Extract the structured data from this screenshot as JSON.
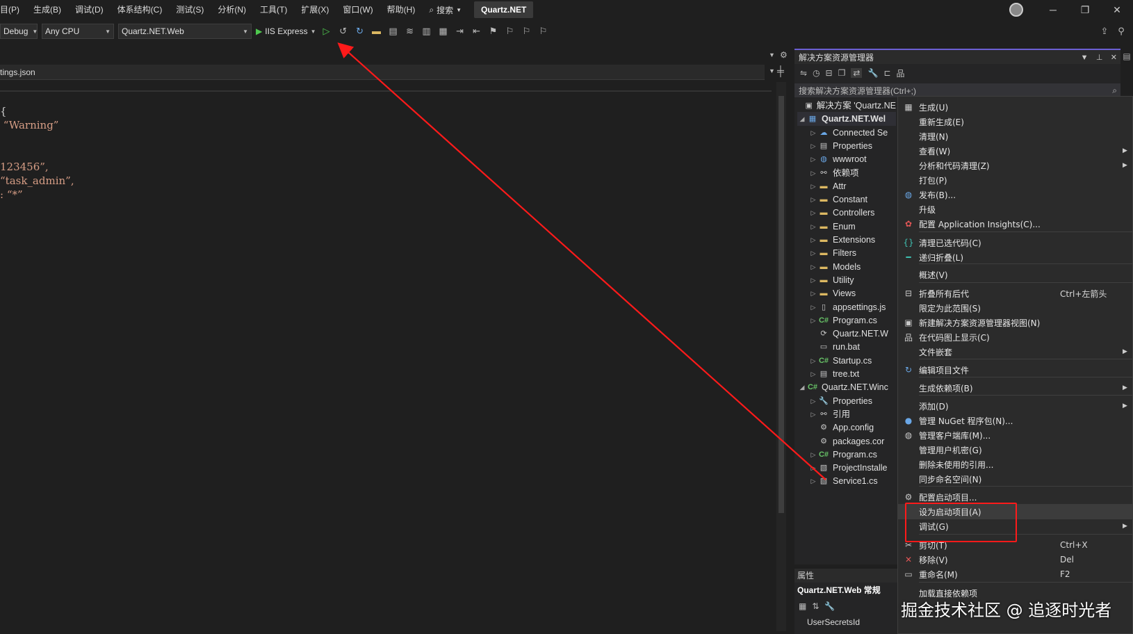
{
  "menubar": {
    "items": [
      "目(P)",
      "生成(B)",
      "调试(D)",
      "体系结构(C)",
      "测试(S)",
      "分析(N)",
      "工具(T)",
      "扩展(X)",
      "窗口(W)",
      "帮助(H)"
    ],
    "search_label": "搜索",
    "title_tab": "Quartz.NET"
  },
  "toolbar": {
    "config": "Debug",
    "platform": "Any CPU",
    "project": "Quartz.NET.Web",
    "run_target": "IIS Express"
  },
  "editor": {
    "tab_label": "tings.json",
    "code_lines": [
      {
        "text": "{",
        "cls": "punc"
      },
      {
        "text": " “Warning”",
        "cls": "str"
      },
      {
        "text": "",
        "cls": "punc"
      },
      {
        "text": "",
        "cls": "punc"
      },
      {
        "text": "123456”,",
        "cls": "str"
      },
      {
        "text": "“task_admin”,",
        "cls": "str"
      },
      {
        "text": ": “*”",
        "cls": "str"
      }
    ]
  },
  "solution_explorer": {
    "title": "解决方案资源管理器",
    "search_placeholder": "搜索解决方案资源管理器(Ctrl+;)",
    "tree": [
      {
        "label": "解决方案 'Quartz.NE",
        "icon": "solution-icon",
        "glyph": "▣",
        "cls": "ic-grey",
        "exp": "",
        "lvl": 0,
        "bold": false
      },
      {
        "label": "Quartz.NET.Wel",
        "icon": "web-project-icon",
        "glyph": "▦",
        "cls": "ic-blue",
        "exp": "◢",
        "lvl": 0,
        "bold": true
      },
      {
        "label": "Connected Se",
        "icon": "connected-services-icon",
        "glyph": "☁",
        "cls": "ic-blue",
        "exp": "▷",
        "lvl": 1,
        "bold": false
      },
      {
        "label": "Properties",
        "icon": "properties-icon",
        "glyph": "▤",
        "cls": "ic-grey",
        "exp": "▷",
        "lvl": 1,
        "bold": false
      },
      {
        "label": "wwwroot",
        "icon": "globe-icon",
        "glyph": "◍",
        "cls": "ic-blue",
        "exp": "▷",
        "lvl": 1,
        "bold": false
      },
      {
        "label": "依赖项",
        "icon": "dependencies-icon",
        "glyph": "⚯",
        "cls": "ic-grey",
        "exp": "▷",
        "lvl": 1,
        "bold": false
      },
      {
        "label": "Attr",
        "icon": "folder-icon",
        "glyph": "▬",
        "cls": "ic-folder",
        "exp": "▷",
        "lvl": 1,
        "bold": false
      },
      {
        "label": "Constant",
        "icon": "folder-icon",
        "glyph": "▬",
        "cls": "ic-folder",
        "exp": "▷",
        "lvl": 1,
        "bold": false
      },
      {
        "label": "Controllers",
        "icon": "folder-icon",
        "glyph": "▬",
        "cls": "ic-folder",
        "exp": "▷",
        "lvl": 1,
        "bold": false
      },
      {
        "label": "Enum",
        "icon": "folder-icon",
        "glyph": "▬",
        "cls": "ic-folder",
        "exp": "▷",
        "lvl": 1,
        "bold": false
      },
      {
        "label": "Extensions",
        "icon": "folder-icon",
        "glyph": "▬",
        "cls": "ic-folder",
        "exp": "▷",
        "lvl": 1,
        "bold": false
      },
      {
        "label": "Filters",
        "icon": "folder-icon",
        "glyph": "▬",
        "cls": "ic-folder",
        "exp": "▷",
        "lvl": 1,
        "bold": false
      },
      {
        "label": "Models",
        "icon": "folder-icon",
        "glyph": "▬",
        "cls": "ic-folder",
        "exp": "▷",
        "lvl": 1,
        "bold": false
      },
      {
        "label": "Utility",
        "icon": "folder-icon",
        "glyph": "▬",
        "cls": "ic-folder",
        "exp": "▷",
        "lvl": 1,
        "bold": false
      },
      {
        "label": "Views",
        "icon": "folder-icon",
        "glyph": "▬",
        "cls": "ic-folder",
        "exp": "▷",
        "lvl": 1,
        "bold": false
      },
      {
        "label": "appsettings.js",
        "icon": "json-file-icon",
        "glyph": "▯",
        "cls": "ic-grey",
        "exp": "▷",
        "lvl": 1,
        "bold": false
      },
      {
        "label": "Program.cs",
        "icon": "csharp-file-icon",
        "glyph": "C#",
        "cls": "ic-cs",
        "exp": "▷",
        "lvl": 1,
        "bold": false
      },
      {
        "label": "Quartz.NET.W",
        "icon": "refresh-file-icon",
        "glyph": "⟳",
        "cls": "ic-grey",
        "exp": "",
        "lvl": 1,
        "bold": false
      },
      {
        "label": "run.bat",
        "icon": "bat-file-icon",
        "glyph": "▭",
        "cls": "ic-grey",
        "exp": "",
        "lvl": 1,
        "bold": false
      },
      {
        "label": "Startup.cs",
        "icon": "csharp-file-icon",
        "glyph": "C#",
        "cls": "ic-cs",
        "exp": "▷",
        "lvl": 1,
        "bold": false
      },
      {
        "label": "tree.txt",
        "icon": "text-file-icon",
        "glyph": "▤",
        "cls": "ic-grey",
        "exp": "▷",
        "lvl": 1,
        "bold": false
      },
      {
        "label": "Quartz.NET.Winc",
        "icon": "csharp-project-icon",
        "glyph": "C#",
        "cls": "ic-cs",
        "exp": "◢",
        "lvl": 0,
        "bold": false
      },
      {
        "label": "Properties",
        "icon": "wrench-icon",
        "glyph": "🔧",
        "cls": "ic-grey",
        "exp": "▷",
        "lvl": 1,
        "bold": false
      },
      {
        "label": "引用",
        "icon": "references-icon",
        "glyph": "⚯",
        "cls": "ic-grey",
        "exp": "▷",
        "lvl": 1,
        "bold": false
      },
      {
        "label": "App.config",
        "icon": "config-file-icon",
        "glyph": "⚙",
        "cls": "ic-grey",
        "exp": "",
        "lvl": 1,
        "bold": false
      },
      {
        "label": "packages.cor",
        "icon": "config-file-icon",
        "glyph": "⚙",
        "cls": "ic-grey",
        "exp": "",
        "lvl": 1,
        "bold": false
      },
      {
        "label": "Program.cs",
        "icon": "csharp-file-icon",
        "glyph": "C#",
        "cls": "ic-cs",
        "exp": "▷",
        "lvl": 1,
        "bold": false
      },
      {
        "label": "ProjectInstalle",
        "icon": "installer-file-icon",
        "glyph": "▧",
        "cls": "ic-grey",
        "exp": "▷",
        "lvl": 1,
        "bold": false
      },
      {
        "label": "Service1.cs",
        "icon": "service-file-icon",
        "glyph": "▧",
        "cls": "ic-grey",
        "exp": "▷",
        "lvl": 1,
        "bold": false
      }
    ]
  },
  "properties": {
    "title": "属性",
    "object_name": "Quartz.NET.Web 常规",
    "first_prop": "UserSecretsId"
  },
  "context_menu": {
    "items": [
      {
        "label": "生成(U)",
        "icon": "build-icon",
        "glyph": "▦",
        "cls": "ic-grey",
        "key": "",
        "sub": false
      },
      {
        "label": "重新生成(E)",
        "icon": "",
        "glyph": "",
        "cls": "",
        "key": "",
        "sub": false
      },
      {
        "label": "清理(N)",
        "icon": "",
        "glyph": "",
        "cls": "",
        "key": "",
        "sub": false
      },
      {
        "label": "查看(W)",
        "icon": "",
        "glyph": "",
        "cls": "",
        "key": "",
        "sub": true
      },
      {
        "label": "分析和代码清理(Z)",
        "icon": "",
        "glyph": "",
        "cls": "",
        "key": "",
        "sub": true
      },
      {
        "label": "打包(P)",
        "icon": "",
        "glyph": "",
        "cls": "",
        "key": "",
        "sub": false
      },
      {
        "label": "发布(B)...",
        "icon": "publish-globe-icon",
        "glyph": "◍",
        "cls": "ic-blue",
        "key": "",
        "sub": false
      },
      {
        "label": "升级",
        "icon": "",
        "glyph": "",
        "cls": "",
        "key": "",
        "sub": false
      },
      {
        "label": "配置 Application Insights(C)...",
        "icon": "insights-icon",
        "glyph": "✿",
        "cls": "ic-red",
        "key": "",
        "sub": false
      },
      {
        "label": "清理已选代码(C)",
        "icon": "braces-icon",
        "glyph": "{}",
        "cls": "ic-teal",
        "key": "",
        "sub": false
      },
      {
        "label": "递归折叠(L)",
        "icon": "collapse-icon",
        "glyph": "━",
        "cls": "ic-teal",
        "key": "",
        "sub": false
      },
      {
        "label": "概述(V)",
        "icon": "",
        "glyph": "",
        "cls": "",
        "key": "",
        "sub": false
      },
      {
        "label": "折叠所有后代",
        "icon": "collapse-all-icon",
        "glyph": "⊟",
        "cls": "ic-grey",
        "key": "Ctrl+左箭头",
        "sub": false
      },
      {
        "label": "限定为此范围(S)",
        "icon": "",
        "glyph": "",
        "cls": "",
        "key": "",
        "sub": false
      },
      {
        "label": "新建解决方案资源管理器视图(N)",
        "icon": "new-view-icon",
        "glyph": "▣",
        "cls": "ic-grey",
        "key": "",
        "sub": false
      },
      {
        "label": "在代码图上显示(C)",
        "icon": "code-map-icon",
        "glyph": "品",
        "cls": "ic-grey",
        "key": "",
        "sub": false
      },
      {
        "label": "文件嵌套",
        "icon": "",
        "glyph": "",
        "cls": "",
        "key": "",
        "sub": true
      },
      {
        "label": "编辑项目文件",
        "icon": "edit-project-icon",
        "glyph": "↻",
        "cls": "ic-blue",
        "key": "",
        "sub": false
      },
      {
        "label": "生成依赖项(B)",
        "icon": "",
        "glyph": "",
        "cls": "",
        "key": "",
        "sub": true
      },
      {
        "label": "添加(D)",
        "icon": "",
        "glyph": "",
        "cls": "",
        "key": "",
        "sub": true
      },
      {
        "label": "管理 NuGet 程序包(N)...",
        "icon": "nuget-icon",
        "glyph": "●",
        "cls": "ic-blue",
        "key": "",
        "sub": false
      },
      {
        "label": "管理客户端库(M)...",
        "icon": "client-lib-icon",
        "glyph": "◍",
        "cls": "ic-grey",
        "key": "",
        "sub": false
      },
      {
        "label": "管理用户机密(G)",
        "icon": "",
        "glyph": "",
        "cls": "",
        "key": "",
        "sub": false
      },
      {
        "label": "删除未使用的引用...",
        "icon": "",
        "glyph": "",
        "cls": "",
        "key": "",
        "sub": false
      },
      {
        "label": "同步命名空间(N)",
        "icon": "",
        "glyph": "",
        "cls": "",
        "key": "",
        "sub": false
      },
      {
        "label": "配置启动项目...",
        "icon": "gear-icon",
        "glyph": "⚙",
        "cls": "ic-grey",
        "key": "",
        "sub": false
      },
      {
        "label": "设为启动项目(A)",
        "icon": "",
        "glyph": "",
        "cls": "",
        "key": "",
        "sub": false
      },
      {
        "label": "调试(G)",
        "icon": "",
        "glyph": "",
        "cls": "",
        "key": "",
        "sub": true
      },
      {
        "label": "剪切(T)",
        "icon": "scissors-icon",
        "glyph": "✂",
        "cls": "ic-grey",
        "key": "Ctrl+X",
        "sub": false
      },
      {
        "label": "移除(V)",
        "icon": "remove-x-icon",
        "glyph": "✕",
        "cls": "ic-red",
        "key": "Del",
        "sub": false
      },
      {
        "label": "重命名(M)",
        "icon": "rename-icon",
        "glyph": "▭",
        "cls": "ic-grey",
        "key": "F2",
        "sub": false
      },
      {
        "label": "加载直接依赖项",
        "icon": "",
        "glyph": "",
        "cls": "",
        "key": "",
        "sub": false
      }
    ]
  },
  "watermark": "掘金技术社区 @ 追逐时光者",
  "colors": {
    "annotation_red": "#ff1a1a",
    "accent": "#6b5fd3",
    "string": "#d69d85"
  }
}
